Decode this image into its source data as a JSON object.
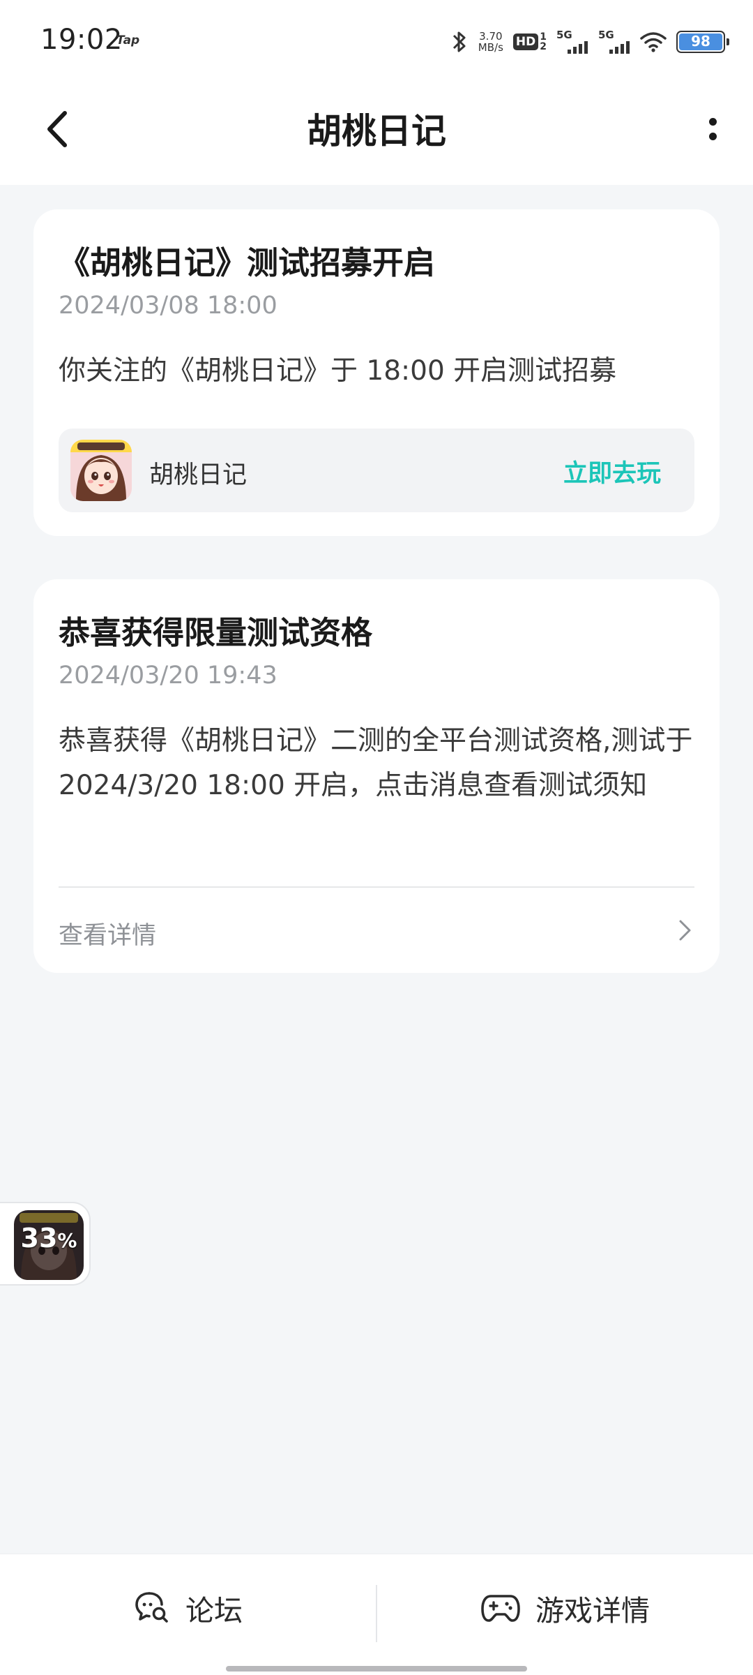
{
  "status_bar": {
    "time": "19:02",
    "tap_label": "Tap",
    "net_speed_value": "3.70",
    "net_speed_unit": "MB/s",
    "hd_label": "HD",
    "hd_sim_top": "1",
    "hd_sim_bottom": "2",
    "sim1_label": "5G",
    "sim2_label": "5G",
    "battery": "98",
    "battery_color": "#4a8fe0"
  },
  "header": {
    "title": "胡桃日记"
  },
  "cards": [
    {
      "title": "《胡桃日记》测试招募开启",
      "date": "2024/03/08 18:00",
      "body": "你关注的《胡桃日记》于 18:00 开启测试招募",
      "game_name": "胡桃日记",
      "action_label": "立即去玩"
    },
    {
      "title": "恭喜获得限量测试资格",
      "date": "2024/03/20 19:43",
      "body": "恭喜获得《胡桃日记》二测的全平台测试资格,测试于 2024/3/20 18:00 开启，点击消息查看测试须知",
      "link_label": "查看详情"
    }
  ],
  "float_widget": {
    "progress_number": "33",
    "progress_unit": "%",
    "progress_fraction": 0.33
  },
  "bottom_bar": {
    "forum_label": "论坛",
    "game_details_label": "游戏详情"
  },
  "colors": {
    "accent": "#1cc5b8",
    "background": "#f4f6f8"
  }
}
